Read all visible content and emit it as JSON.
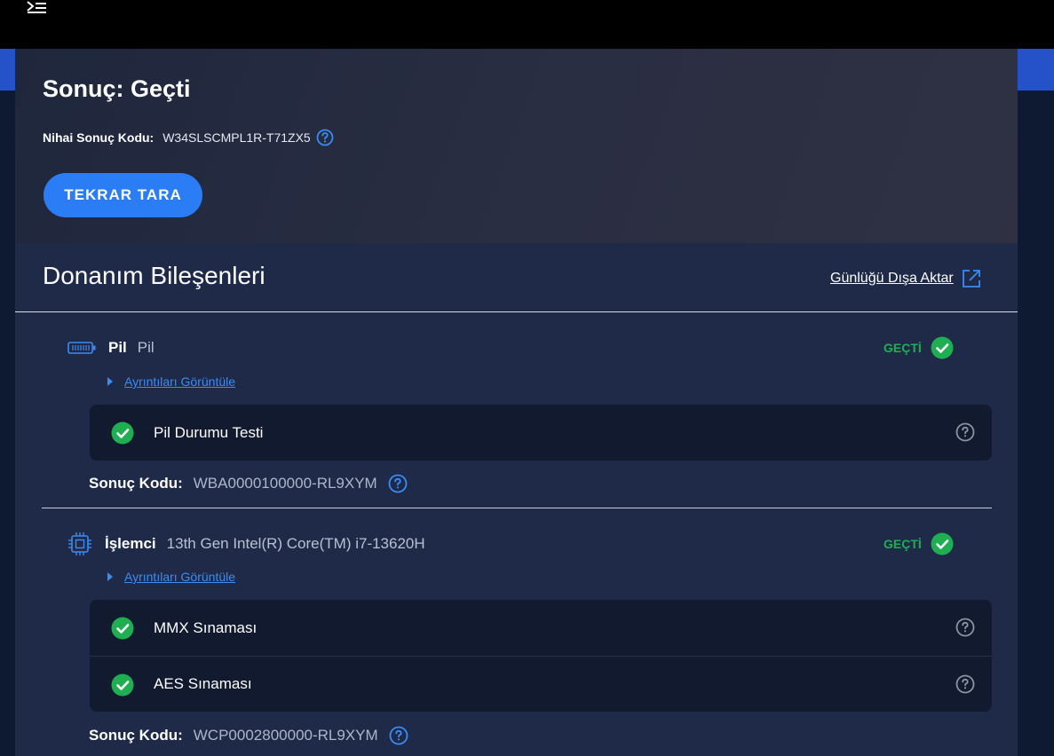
{
  "window": {
    "menu_icon": "terminal-menu-icon"
  },
  "summary": {
    "title": "Sonuç: Geçti",
    "final_code_label": "Nihai Sonuç Kodu:",
    "final_code_value": "W34SLSCMPL1R-T71ZX5",
    "rescan_label": "TEKRAR TARA"
  },
  "hardware": {
    "section_title": "Donanım Bileşenleri",
    "export_label": "Günlüğü Dışa Aktar",
    "components": [
      {
        "icon": "battery-icon",
        "name": "Pil",
        "description": "Pil",
        "status": "GEÇTİ",
        "details_label": "Ayrıntıları Görüntüle",
        "tests": [
          {
            "name": "Pil Durumu Testi"
          }
        ],
        "result_code_label": "Sonuç Kodu:",
        "result_code_value": "WBA0000100000-RL9XYM"
      },
      {
        "icon": "cpu-icon",
        "name": "İşlemci",
        "description": "13th Gen Intel(R) Core(TM) i7-13620H",
        "status": "GEÇTİ",
        "details_label": "Ayrıntıları Görüntüle",
        "tests": [
          {
            "name": "MMX Sınaması"
          },
          {
            "name": "AES Sınaması"
          }
        ],
        "result_code_label": "Sonuç Kodu:",
        "result_code_value": "WCP0002800000-RL9XYM"
      }
    ]
  },
  "colors": {
    "accent_blue": "#2a7df4",
    "pass_green": "#1fae52",
    "link_blue": "#3a8cf5"
  }
}
